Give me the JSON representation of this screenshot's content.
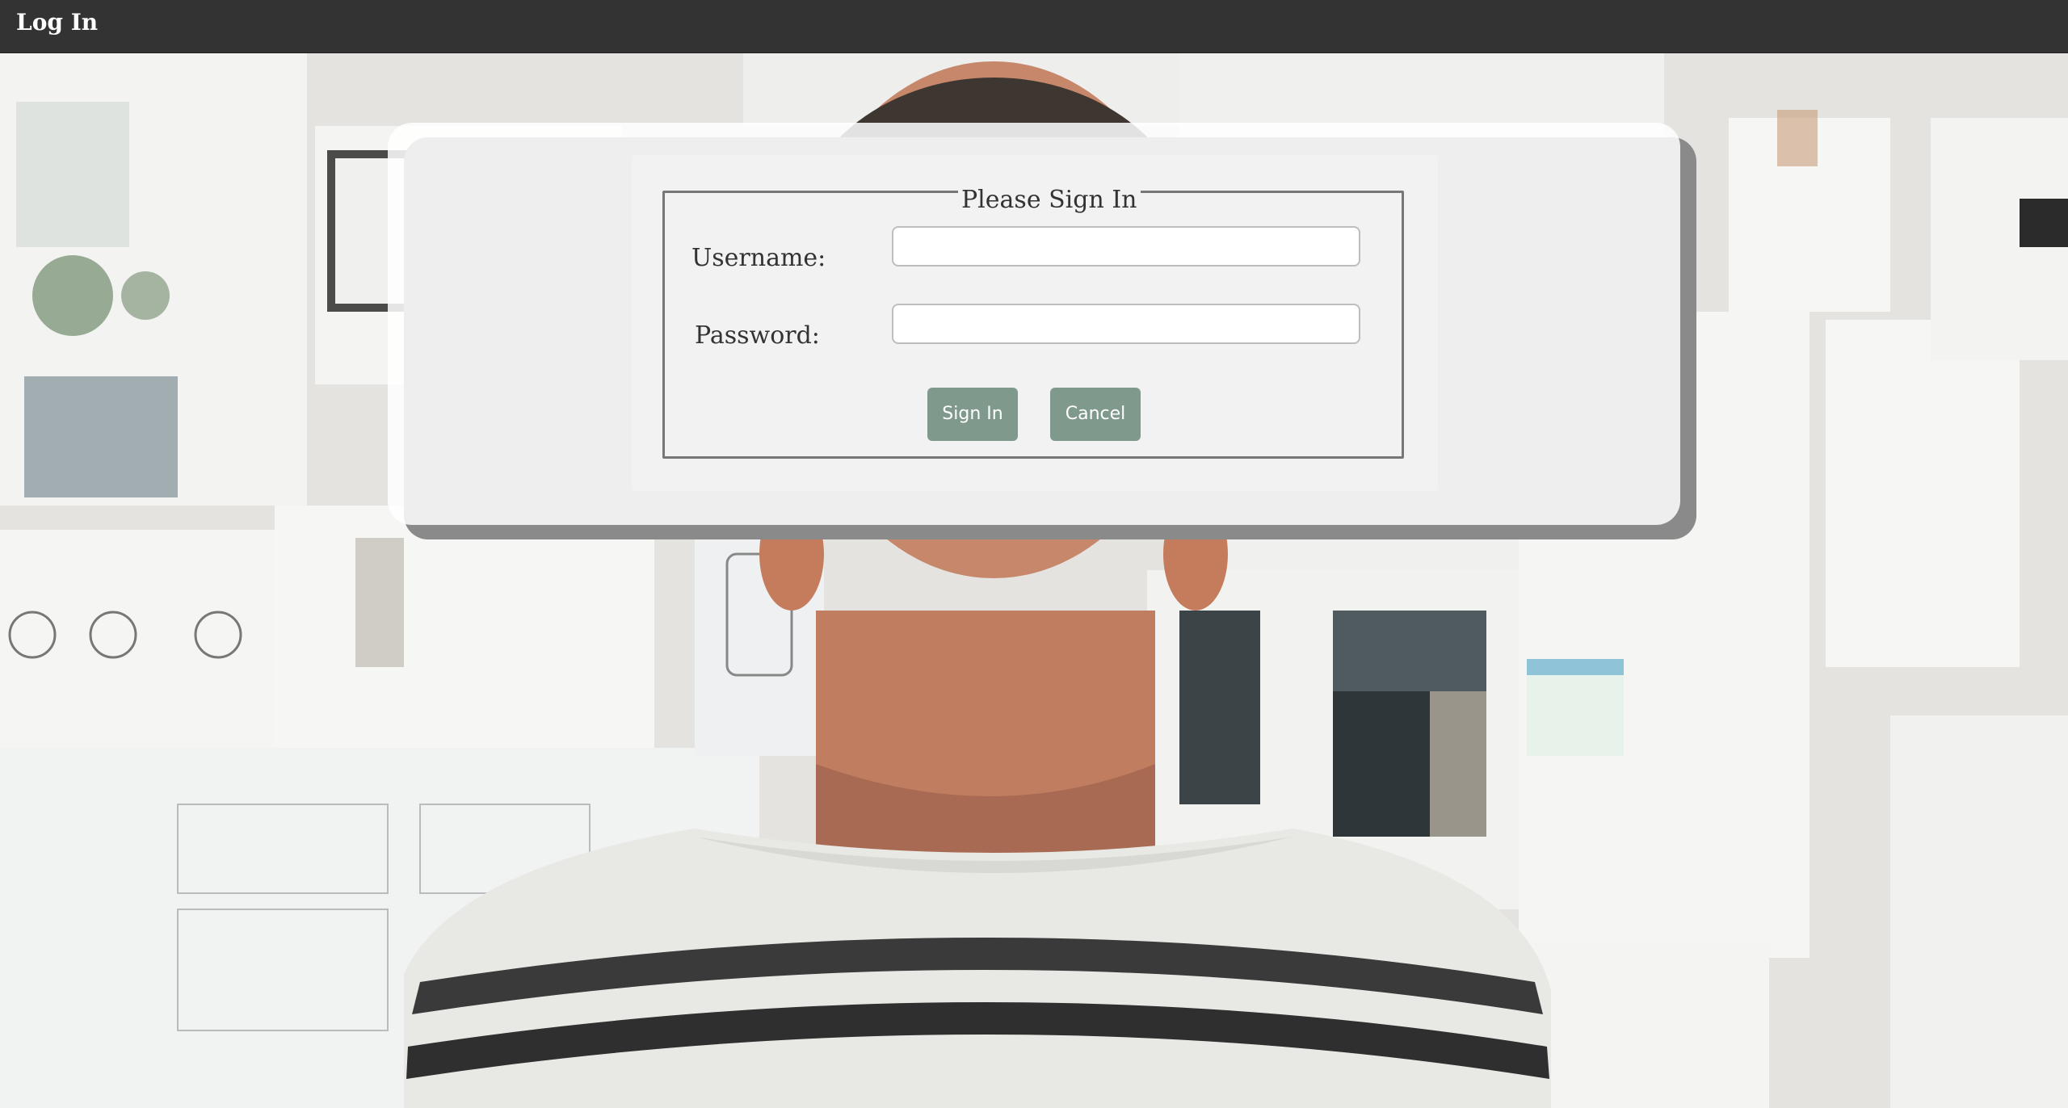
{
  "header": {
    "title": "Log In"
  },
  "login_form": {
    "legend": "Please Sign In",
    "username_label": "Username:",
    "username_value": "",
    "password_label": "Password:",
    "password_value": "",
    "signin_label": "Sign In",
    "cancel_label": "Cancel"
  },
  "colors": {
    "topbar": "#333333",
    "button": "#7f9a8c",
    "panel": "#f2f2f2",
    "card_shadow": "#8a8a8a"
  }
}
